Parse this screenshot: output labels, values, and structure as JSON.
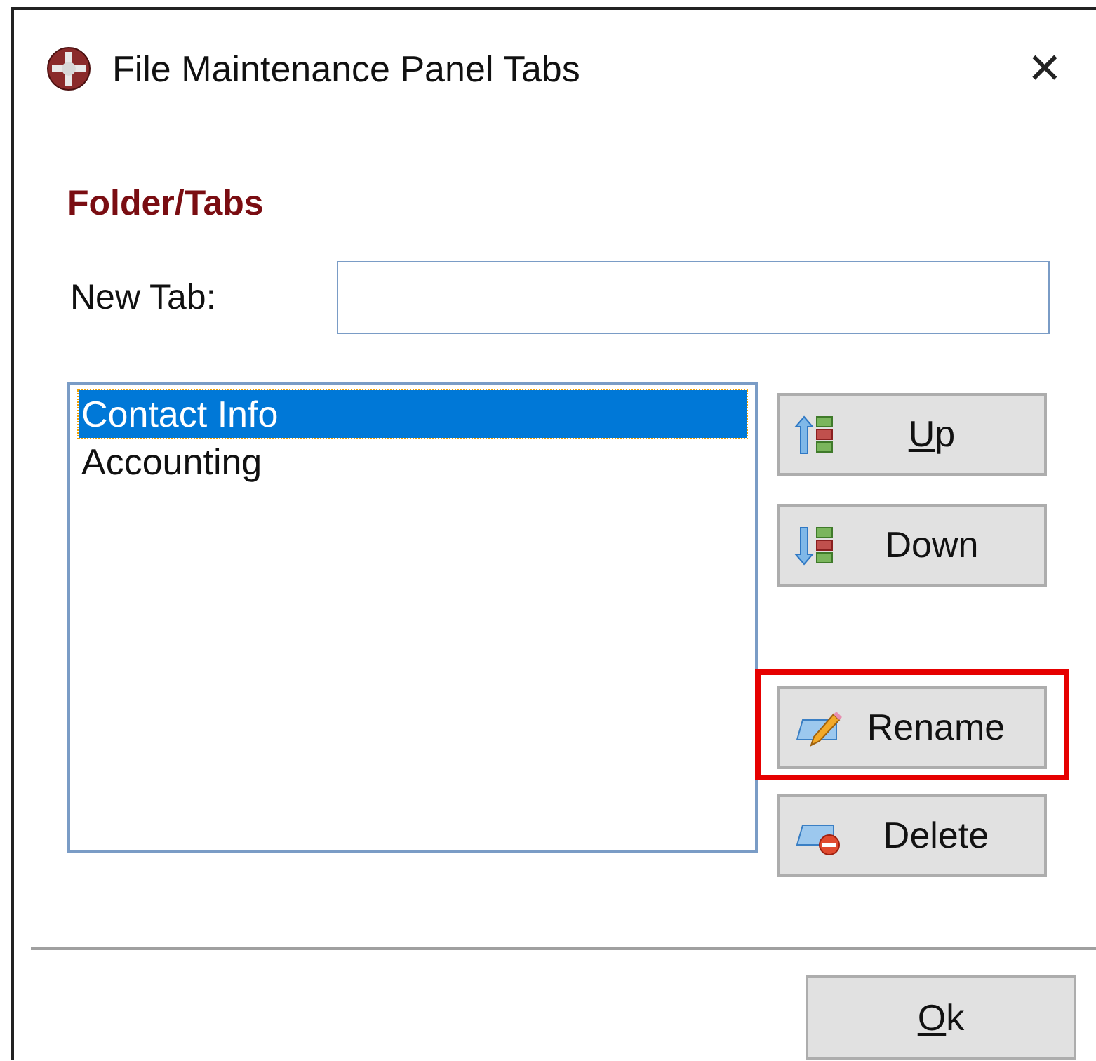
{
  "window": {
    "title": "File Maintenance Panel Tabs",
    "close": "✕"
  },
  "heading": "Folder/Tabs",
  "new_tab": {
    "label": "New Tab:"
  },
  "tabs_list": [
    {
      "label": "Contact Info",
      "selected": true
    },
    {
      "label": "Accounting",
      "selected": false
    }
  ],
  "side_buttons": [
    {
      "kind": "up",
      "label": "Up",
      "underline_first": true,
      "highlighted": false
    },
    {
      "kind": "down",
      "label": "Down",
      "underline_first": false,
      "highlighted": false
    },
    {
      "kind": "rename",
      "label": "Rename",
      "underline_first": false,
      "highlighted": true
    },
    {
      "kind": "delete",
      "label": "Delete",
      "underline_first": false,
      "highlighted": false
    }
  ],
  "ok_button": {
    "label": "Ok",
    "underline_first": true
  }
}
